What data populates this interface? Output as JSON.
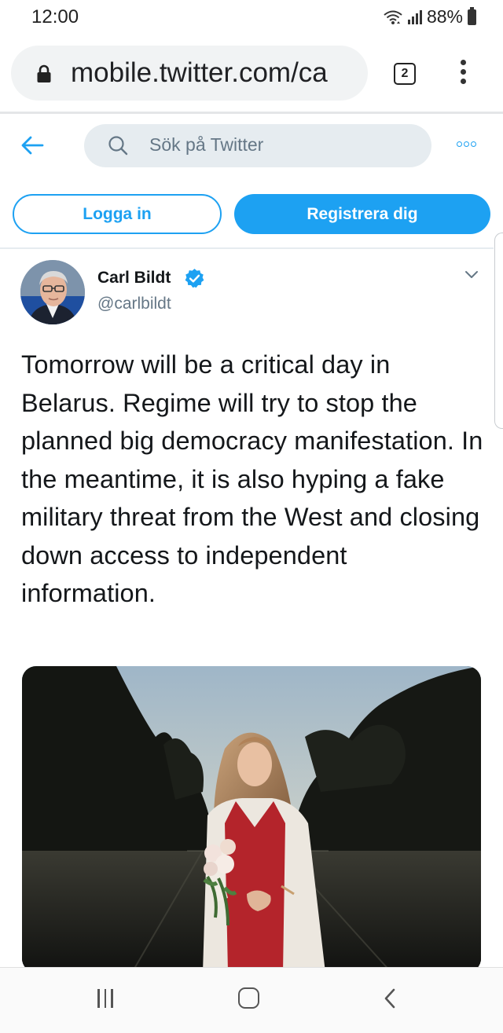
{
  "status_bar": {
    "time": "12:00",
    "battery": "88%",
    "icons": [
      "wifi-icon",
      "signal-icon",
      "battery-icon"
    ]
  },
  "browser": {
    "url": "mobile.twitter.com/ca",
    "tab_count": "2",
    "icons": [
      "lock-icon",
      "menu-dots-icon"
    ]
  },
  "twitter_header": {
    "search_placeholder": "Sök på Twitter",
    "icons": [
      "back-arrow-icon",
      "search-icon",
      "more-icon"
    ]
  },
  "auth": {
    "login_label": "Logga in",
    "register_label": "Registrera dig"
  },
  "tweet": {
    "author_name": "Carl Bildt",
    "author_handle": "@carlbildt",
    "verified": true,
    "text": "Tomorrow will be a critical day in Belarus. Regime will try to stop the planned big democracy manifestation. In the meantime, it is also hyping a fake military threat from the West and closing down access to independent information.",
    "media": "photo"
  },
  "colors": {
    "accent": "#1da1f2",
    "text": "#14171a",
    "secondary_text": "#657786",
    "search_bg": "#e6ecf0"
  },
  "nav_bar": {
    "icons": [
      "recents-icon",
      "home-icon",
      "back-icon"
    ]
  }
}
